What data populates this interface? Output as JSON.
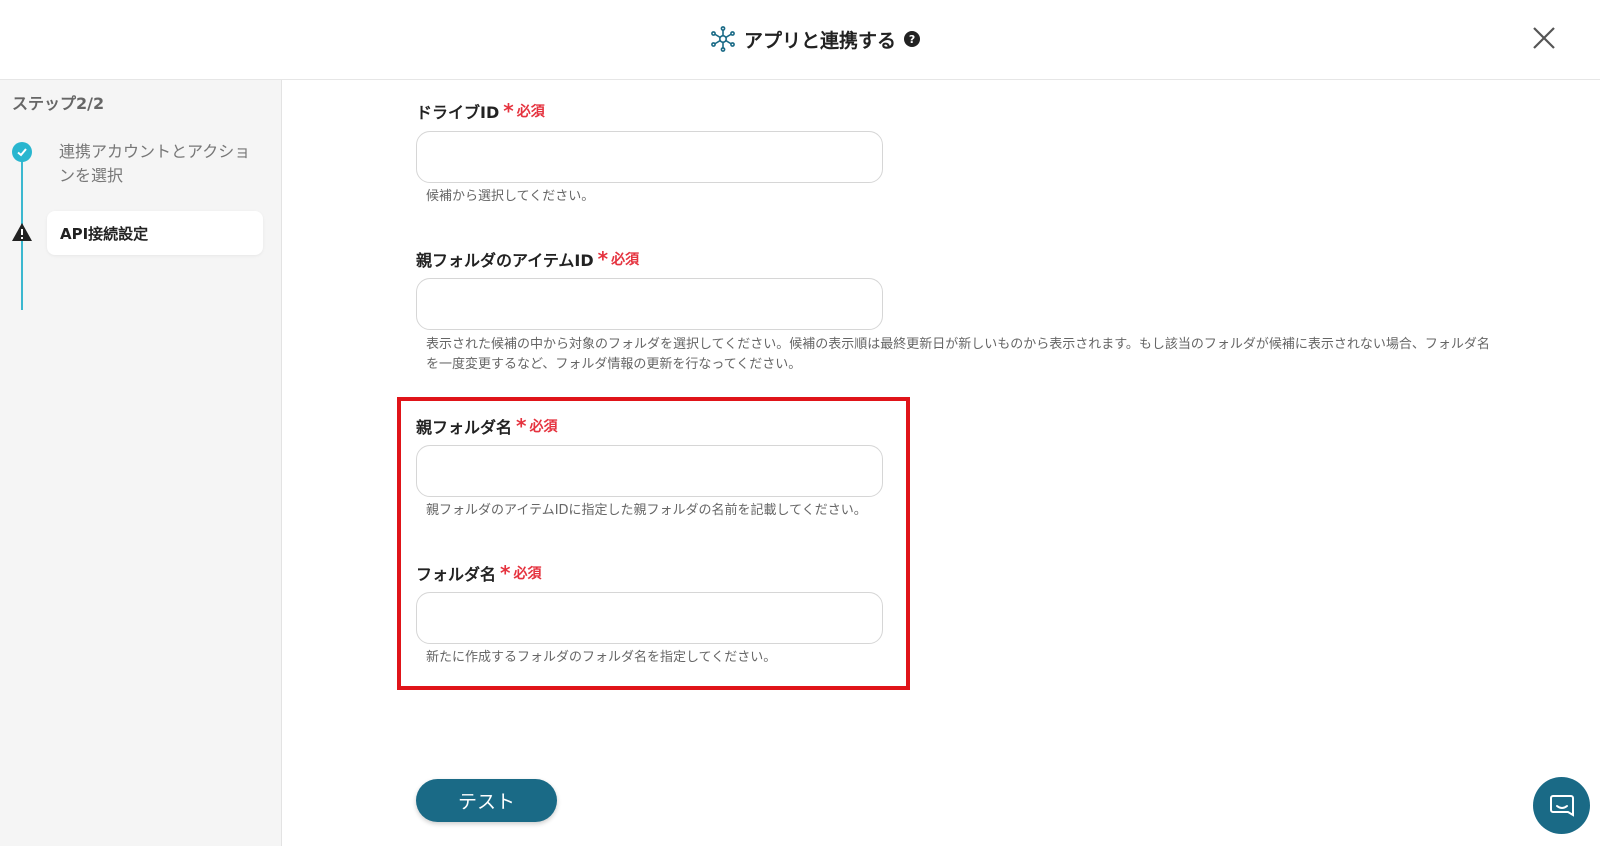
{
  "header": {
    "title": "アプリと連携する",
    "help_icon": "?",
    "icon": "network-hub-icon",
    "close_icon": "close-icon"
  },
  "sidebar": {
    "step_heading": "ステップ2/2",
    "steps": [
      {
        "label": "連携アカウントとアクションを選択",
        "status": "complete"
      },
      {
        "label": "API接続設定",
        "status": "warning"
      }
    ]
  },
  "form": {
    "required_text": "必須",
    "fields": [
      {
        "label": "ドライブID",
        "value": "",
        "help": "候補から選択してください。"
      },
      {
        "label": "親フォルダのアイテムID",
        "value": "",
        "help": "表示された候補の中から対象のフォルダを選択してください。候補の表示順は最終更新日が新しいものから表示されます。もし該当のフォルダが候補に表示されない場合、フォルダ名を一度変更するなど、フォルダ情報の更新を行なってください。"
      },
      {
        "label": "親フォルダ名",
        "value": "",
        "help": "親フォルダのアイテムIDに指定した親フォルダの名前を記載してください。"
      },
      {
        "label": "フォルダ名",
        "value": "",
        "help": "新たに作成するフォルダのフォルダ名を指定してください。"
      }
    ]
  },
  "test_button": "テスト",
  "colors": {
    "accent": "#1a6a86",
    "required": "#e5333f",
    "highlight": "#e01419",
    "step_complete": "#29b6cf"
  }
}
